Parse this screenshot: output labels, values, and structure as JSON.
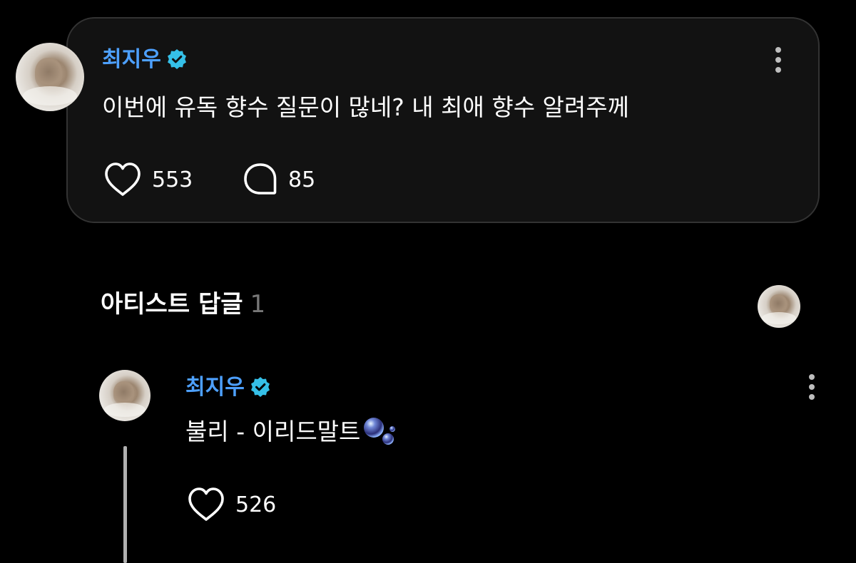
{
  "post": {
    "author": "최지우",
    "text": "이번에 유독 향수 질문이 많네? 내 최애 향수 알려주께",
    "likes": "553",
    "comments": "85"
  },
  "replies_section": {
    "title": "아티스트 답글",
    "count": "1"
  },
  "reply": {
    "author": "최지우",
    "text": "불리 - 이리드말트",
    "likes": "526"
  },
  "icons": {
    "verified": "verified-badge-icon",
    "more": "vertical-dots-icon",
    "like": "heart-icon",
    "comment": "speech-bubble-icon",
    "emoji": "bubbles-emoji"
  },
  "colors": {
    "author": "#4da0ff",
    "verified_badge": "#35c0e8",
    "card_background": "#121212",
    "page_background": "#000000"
  }
}
